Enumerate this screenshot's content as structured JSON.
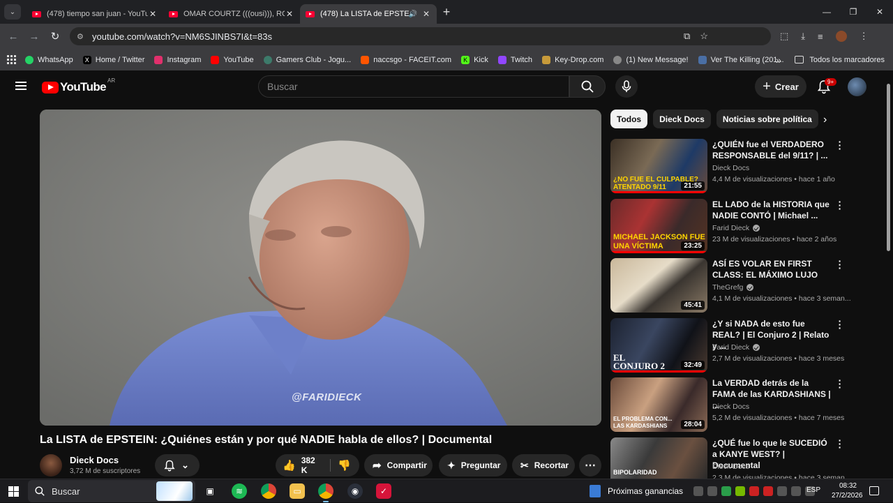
{
  "browser": {
    "tabs": [
      {
        "title": "(478) tiempo san juan - YouTube",
        "active": false,
        "audio": false
      },
      {
        "title": "OMAR COURTZ (((ousi))), ROA",
        "active": false,
        "audio": false
      },
      {
        "title": "(478) La LISTA de EPSTEIN: ¿",
        "active": true,
        "audio": true
      }
    ],
    "url": "youtube.com/watch?v=NM6SJINBS7I&t=83s",
    "bookmarks": [
      {
        "label": "WhatsApp",
        "color": "#25d366"
      },
      {
        "label": "Home / Twitter",
        "color": "#000000"
      },
      {
        "label": "Instagram",
        "color": "#e1306c"
      },
      {
        "label": "YouTube",
        "color": "#ff0000"
      },
      {
        "label": "Gamers Club - Jogu...",
        "color": "#3d7a6a"
      },
      {
        "label": "naccsgo - FACEIT.com",
        "color": "#ff5500"
      },
      {
        "label": "Kick",
        "color": "#53fc18"
      },
      {
        "label": "Twitch",
        "color": "#9146ff"
      },
      {
        "label": "Key-Drop.com",
        "color": "#c79a3a"
      },
      {
        "label": "(1) New Message!",
        "color": "#888888"
      },
      {
        "label": "Ver The Killing (201...",
        "color": "#4a6fa5"
      }
    ],
    "all_bookmarks": "Todos los marcadores"
  },
  "youtube": {
    "logo": "YouTube",
    "country": "AR",
    "search_placeholder": "Buscar",
    "create_label": "Crear",
    "notifications_badge": "9+"
  },
  "video": {
    "title": "La LISTA de EPSTEIN: ¿Quiénes están y por qué NADIE habla de ellos? | Documental",
    "watermark": "@FARIDIECK",
    "channel": "Dieck Docs",
    "subscribers": "3,72 M de suscriptores",
    "likes": "382 K",
    "share": "Compartir",
    "ask": "Preguntar",
    "clip": "Recortar"
  },
  "chips": [
    "Todos",
    "Dieck Docs",
    "Noticias sobre política"
  ],
  "recommendations": [
    {
      "title": "¿QUIÉN fue el VERDADERO RESPONSABLE del 9/11? | ...",
      "channel": "Dieck Docs",
      "verified": false,
      "meta": "4,4 M de visualizaciones • hace 1 año",
      "duration": "21:55",
      "thumb_text": "¿NO FUE EL CULPABLE?\nATENTADO 9/11",
      "progress": 1.0
    },
    {
      "title": "EL LADO de la HISTORIA que NADIE CONTÓ | Michael ...",
      "channel": "Farid Dieck",
      "verified": true,
      "meta": "23 M de visualizaciones • hace 2 años",
      "duration": "23:25",
      "thumb_text": "MICHAEL JACKSON FUE\nUNA VÍCTIMA",
      "progress": 1.0
    },
    {
      "title": "ASÍ ES VOLAR EN FIRST CLASS: EL MÁXIMO LUJO",
      "channel": "TheGrefg",
      "verified": true,
      "meta": "4,1 M de visualizaciones • hace 3 seman...",
      "duration": "45:41",
      "thumb_text": "",
      "progress": 0
    },
    {
      "title": "¿Y si NADA de esto fue REAL? | El Conjuro 2 | Relato y ...",
      "channel": "Farid Dieck",
      "verified": true,
      "meta": "2,7 M de visualizaciones • hace 3 meses",
      "duration": "32:49",
      "thumb_text": "EL\nCONJURO 2",
      "progress": 1.0
    },
    {
      "title": "La VERDAD detrás de la FAMA de las KARDASHIANS | ...",
      "channel": "Dieck Docs",
      "verified": false,
      "meta": "5,2 M de visualizaciones • hace 7 meses",
      "duration": "28:04",
      "thumb_text": "EL PROBLEMA CON...\nLAS KARDASHIANS",
      "progress": 0
    },
    {
      "title": "¿QUÉ fue lo que le SUCEDIÓ a KANYE WEST? | Documental",
      "channel": "Dieck Docs",
      "verified": false,
      "meta": "2,3 M de visualizaciones • hace 3 seman...",
      "duration": "",
      "thumb_text": "BIPOLARIDAD",
      "progress": 0
    }
  ],
  "taskbar": {
    "search": "Buscar",
    "weather": "Próximas ganancias",
    "language": "ESP",
    "time": "08:32",
    "date": "27/2/2026"
  }
}
